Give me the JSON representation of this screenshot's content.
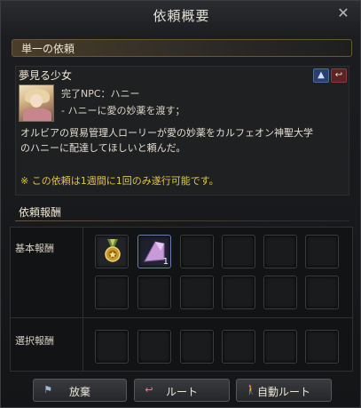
{
  "window": {
    "title": "依頼概要",
    "close_icon": "close-icon"
  },
  "section": {
    "label": "単一の依頼"
  },
  "quest": {
    "name": "夢見る少女",
    "icons": [
      "navigate-up-icon",
      "hook-icon"
    ],
    "complete_npc": "完了NPC：ハニー",
    "objective": "- ハニーに愛の妙薬を渡す；",
    "description_line1": "オルビアの貿易管理人ローリーが愛の妙薬をカルフェオン神聖大学",
    "description_line2": "のハニーに配達してほしいと頼んだ。",
    "note": "※ この依頼は1週間に1回のみ遂行可能です。"
  },
  "rewards": {
    "header": "依頼報酬",
    "basic_label": "基本報酬",
    "select_label": "選択報酬",
    "basic_items": [
      {
        "name": "medal-icon",
        "count": ""
      },
      {
        "name": "scroll-icon",
        "count": "1"
      }
    ]
  },
  "buttons": {
    "give_up": "放棄",
    "route": "ルート",
    "auto_route": "自動ルート"
  },
  "colors": {
    "note_yellow": "#e1c646",
    "accent_gold": "#6a5738"
  }
}
